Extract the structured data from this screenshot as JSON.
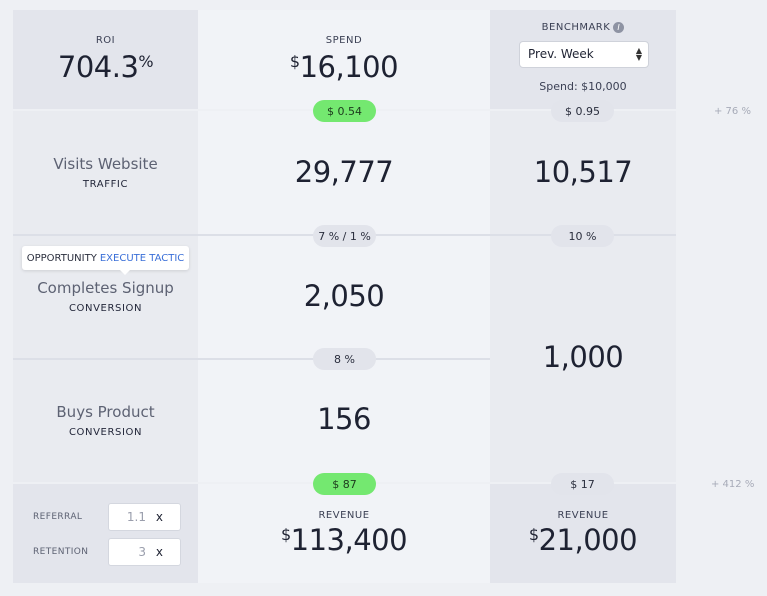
{
  "top": {
    "roi_label": "ROI",
    "roi_value": "704.3",
    "roi_unit": "%",
    "spend_label": "SPEND",
    "spend_currency": "$",
    "spend_value": "16,100",
    "benchmark_label": "BENCHMARK",
    "benchmark_info": "i",
    "benchmark_selected": "Prev. Week",
    "benchmark_spend": "Spend: $10,000"
  },
  "cost_pills": {
    "main_top": "$ 0.54",
    "bench_top": "$ 0.95",
    "delta_top": "+ 76 %",
    "main_bottom": "$ 87",
    "bench_bottom": "$ 17",
    "delta_bottom": "+ 412 %"
  },
  "stages": [
    {
      "title": "Visits Website",
      "sub": "TRAFFIC",
      "value": "29,777"
    },
    {
      "title": "Completes Signup",
      "sub": "CONVERSION",
      "value": "2,050"
    },
    {
      "title": "Buys Product",
      "sub": "CONVERSION",
      "value": "156"
    }
  ],
  "rates": {
    "main_1": "7 % / 1 %",
    "bench_1": "10 %",
    "main_2": "8 %"
  },
  "benchmark_values": {
    "traffic": "10,517",
    "conversion": "1,000"
  },
  "tooltip": {
    "label": "OPPORTUNITY",
    "link": "EXECUTE TACTIC"
  },
  "bottom": {
    "referral_label": "REFERRAL",
    "referral_value": "1.1",
    "retention_label": "RETENTION",
    "retention_value": "3",
    "multiplier_symbol": "x",
    "revenue_label": "REVENUE",
    "revenue_currency": "$",
    "revenue_value": "113,400",
    "bench_revenue_label": "REVENUE",
    "bench_revenue_currency": "$",
    "bench_revenue_value": "21,000"
  },
  "colors": {
    "green_pill": "#74e870",
    "gray_panel": "#e3e5ec",
    "light_panel": "#f1f3f7",
    "link": "#3a6fd8"
  }
}
